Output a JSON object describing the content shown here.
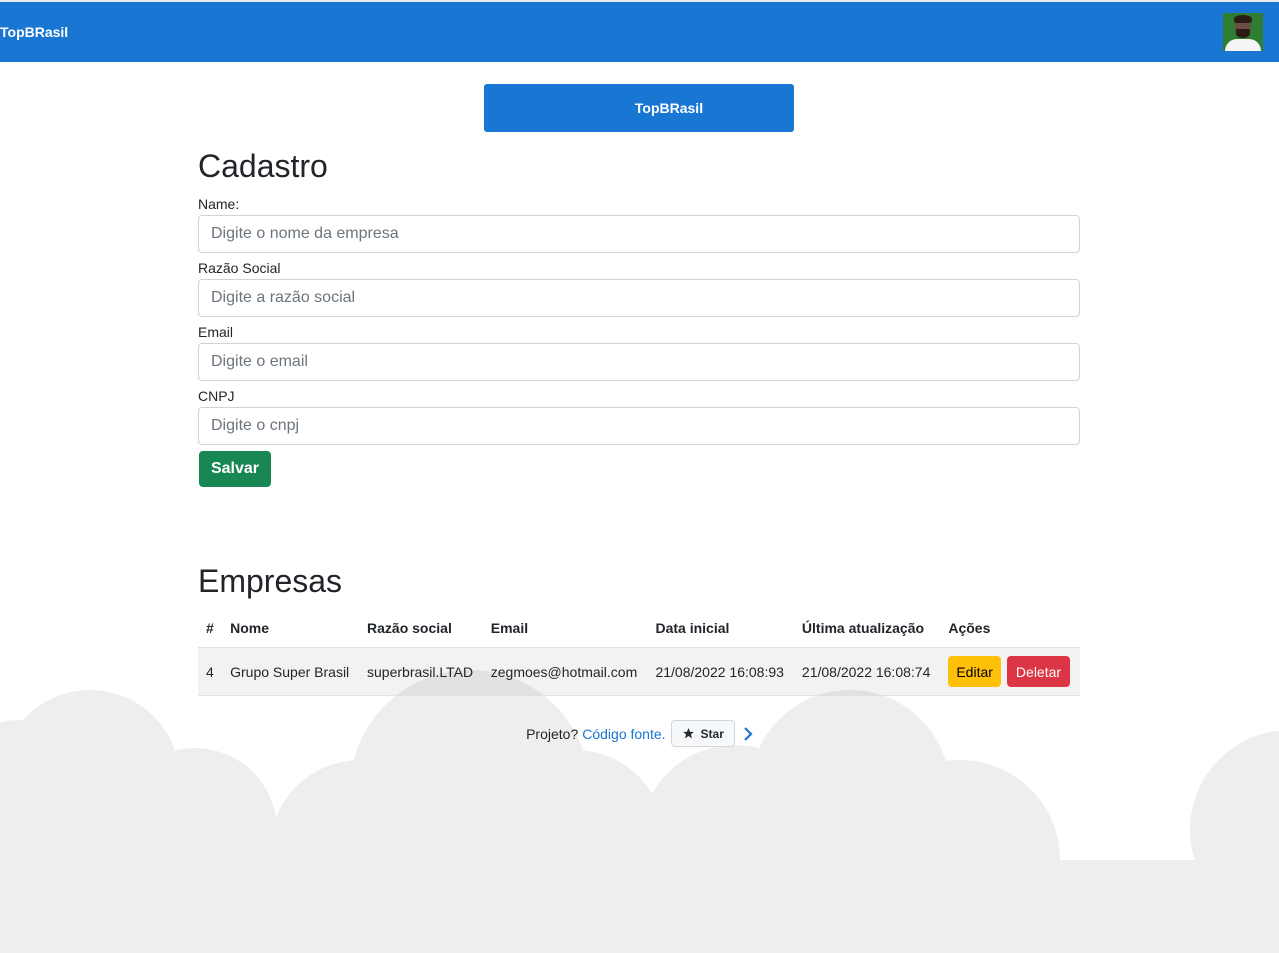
{
  "app": {
    "brand": "TopBRasil",
    "hero_button": "TopBRasil"
  },
  "form": {
    "title": "Cadastro",
    "fields": [
      {
        "label": "Name:",
        "placeholder": "Digite o nome da empresa"
      },
      {
        "label": "Razão Social",
        "placeholder": "Digite a razão social"
      },
      {
        "label": "Email",
        "placeholder": "Digite o email"
      },
      {
        "label": "CNPJ",
        "placeholder": "Digite o cnpj"
      }
    ],
    "save_label": "Salvar"
  },
  "table": {
    "title": "Empresas",
    "headers": [
      "#",
      "Nome",
      "Razão social",
      "Email",
      "Data inicial",
      "Última atualização",
      "Ações"
    ],
    "rows": [
      {
        "id": "4",
        "nome": "Grupo Super Brasil",
        "razao": "superbrasil.LTAD",
        "email": "zegmoes@hotmail.com",
        "data_inicial": "21/08/2022 16:08:93",
        "ultima": "21/08/2022 16:08:74",
        "edit_label": "Editar",
        "delete_label": "Deletar"
      }
    ]
  },
  "footer": {
    "text": "Projeto?",
    "link": "Código fonte.",
    "star_label": "Star"
  },
  "colors": {
    "primary": "#1976d2",
    "success": "#198754",
    "warning": "#ffc107",
    "danger": "#dc3545",
    "cloud": "#eeeeee"
  }
}
